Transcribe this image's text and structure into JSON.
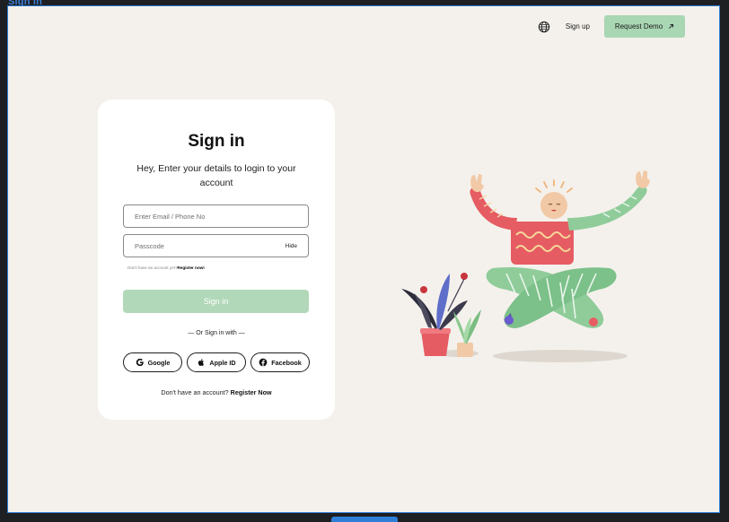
{
  "frame": {
    "label": "Sign in"
  },
  "nav": {
    "globe_icon": "globe-icon",
    "signup_label": "Sign up",
    "demo_label": "Request Demo",
    "demo_icon": "arrow-up-right-icon"
  },
  "card": {
    "title": "Sign in",
    "subtitle": "Hey, Enter your details to login to your account",
    "email_placeholder": "Enter Email / Phone No",
    "password_placeholder": "Passcode",
    "hide_label": "Hide",
    "register_hint_text": "Don't have an account yet?",
    "register_hint_link": "Register now!",
    "signin_label": "Sign in",
    "or_text": "— Or Sign in with —",
    "social": {
      "google": "Google",
      "apple": "Apple ID",
      "facebook": "Facebook"
    },
    "bottom_text": "Don't have an account?",
    "bottom_link": "Register Now"
  },
  "colors": {
    "background": "#f4f1ec",
    "accent": "#a9d6b3",
    "card": "#ffffff"
  }
}
